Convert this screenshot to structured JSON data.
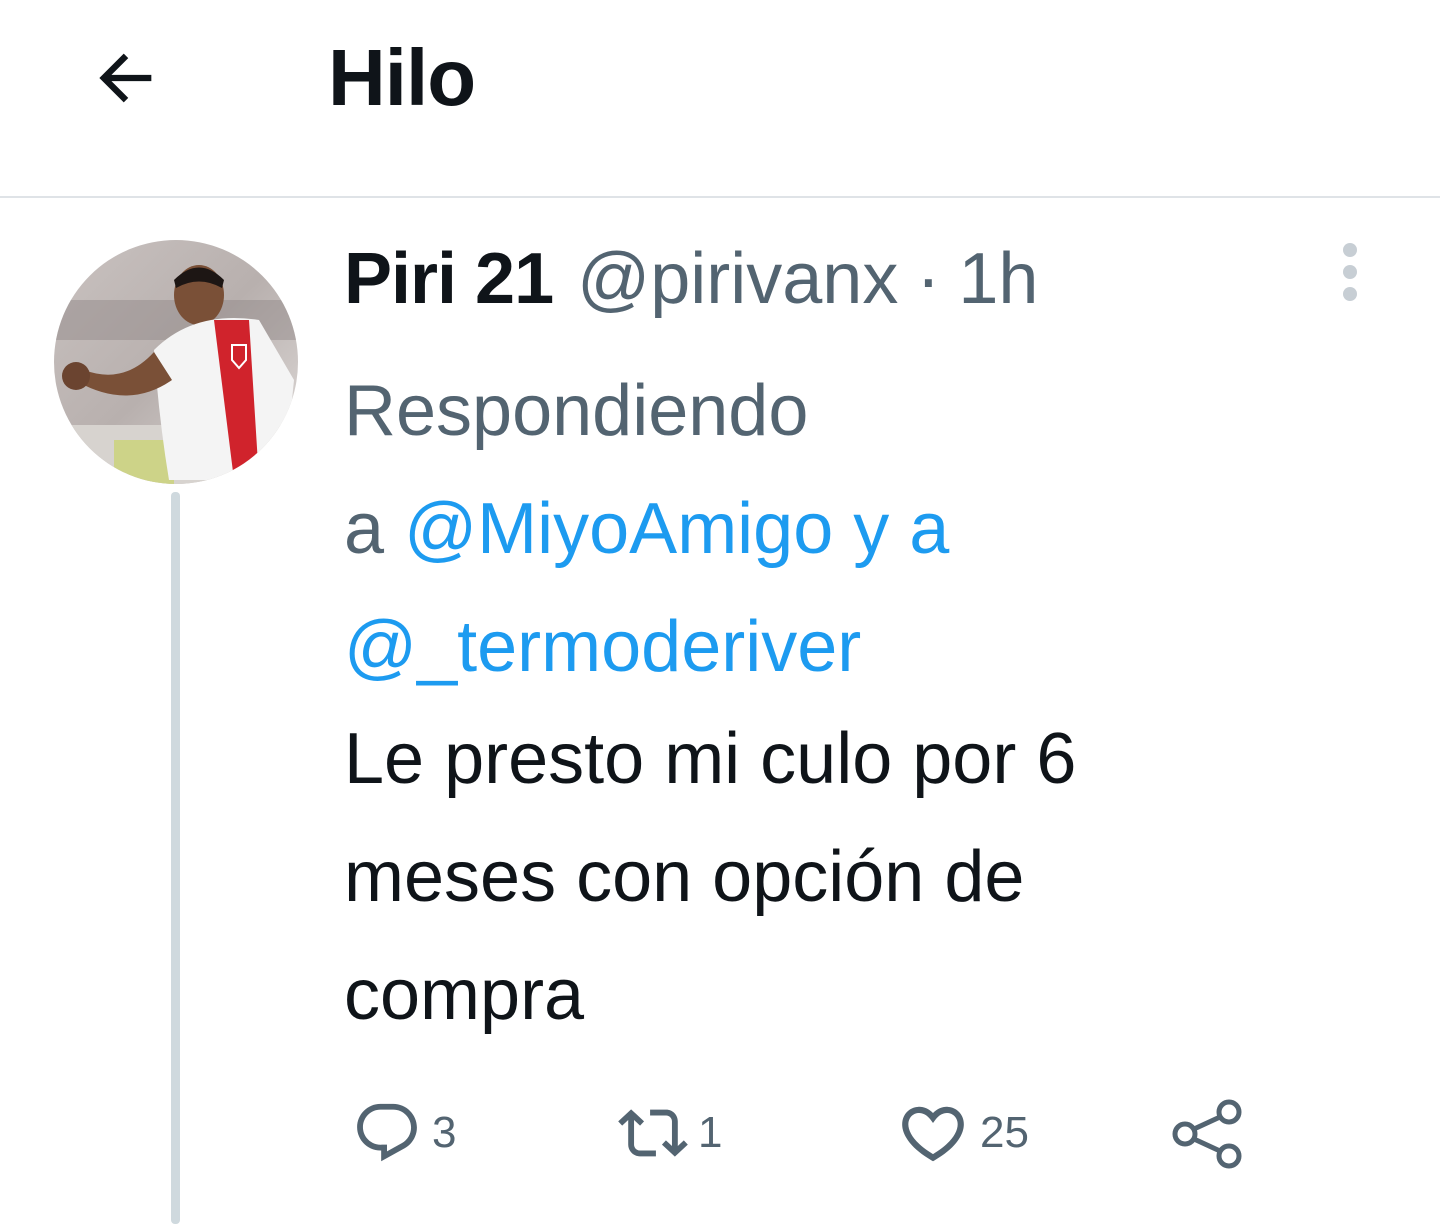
{
  "header": {
    "title": "Hilo",
    "back_icon": "arrow-left-icon"
  },
  "tweet": {
    "display_name": "Piri 21",
    "handle": "@pirivanx",
    "separator": "·",
    "time": "1h",
    "reply_prefix": "Respondiendo",
    "reply_a": "a",
    "mention_1": "@MiyoAmigo",
    "reply_y_a": "y a",
    "mention_2": "@_termoderiver",
    "text_lines": [
      "Le presto mi culo por 6",
      "meses con opción de",
      "compra"
    ]
  },
  "actions": {
    "reply_count": "3",
    "retweet_count": "1",
    "like_count": "25"
  },
  "colors": {
    "text_primary": "#0f1419",
    "text_secondary": "#536471",
    "link": "#1d9bf0",
    "divider": "#dfe3e7",
    "thread_line": "#cfd9de"
  }
}
